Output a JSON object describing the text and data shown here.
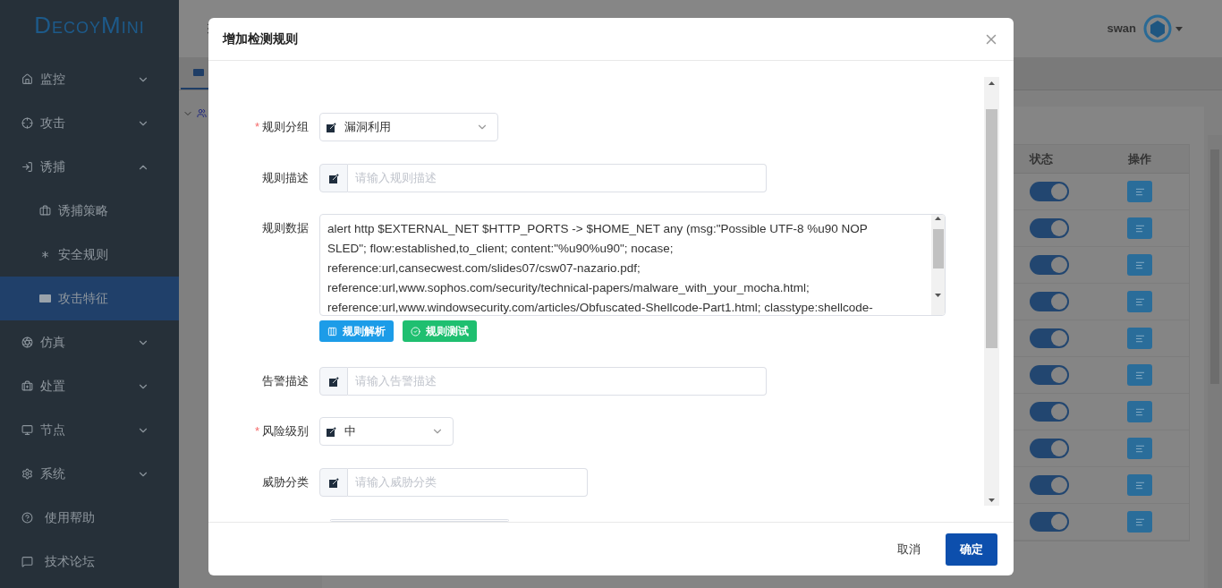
{
  "sidebar": {
    "logo": "DecoyMini",
    "items": [
      {
        "kind": "home",
        "label": "监控",
        "expanded": false
      },
      {
        "kind": "target",
        "label": "攻击",
        "expanded": false
      },
      {
        "kind": "login",
        "label": "诱捕",
        "expanded": true,
        "children": [
          {
            "kind": "bag",
            "label": "诱捕策略",
            "selected": false
          },
          {
            "kind": "asterisk",
            "label": "安全规则",
            "selected": false
          },
          {
            "kind": "md",
            "label": "攻击特征",
            "selected": true
          }
        ]
      },
      {
        "kind": "aperture",
        "label": "仿真",
        "expanded": false
      },
      {
        "kind": "kit",
        "label": "处置",
        "expanded": false
      },
      {
        "kind": "monitor",
        "label": "节点",
        "expanded": false
      },
      {
        "kind": "gear",
        "label": "系统",
        "expanded": false
      },
      {
        "kind": "help",
        "label": "使用帮助"
      },
      {
        "kind": "chat",
        "label": "技术论坛"
      }
    ]
  },
  "header": {
    "user": "swan"
  },
  "table": {
    "columns": [
      "状态",
      "操作"
    ],
    "rows": [
      {
        "on": true
      },
      {
        "on": true
      },
      {
        "on": true
      },
      {
        "on": true
      },
      {
        "on": true
      },
      {
        "on": true
      },
      {
        "on": true
      },
      {
        "on": true
      },
      {
        "on": true
      },
      {
        "on": true
      }
    ]
  },
  "dialog": {
    "title": "增加检测规则",
    "required_mark": "*",
    "fields": [
      {
        "kind": "select",
        "label": "规则分组",
        "required": true,
        "value": "漏洞利用"
      },
      {
        "kind": "input",
        "label": "规则描述",
        "required": false,
        "placeholder": "请输入规则描述"
      },
      {
        "kind": "textarea",
        "label": "规则数据",
        "required": false,
        "lines": [
          "alert http $EXTERNAL_NET $HTTP_PORTS -> $HOME_NET any (msg:\"Possible UTF-8 %u90 NOP",
          "SLED\"; flow:established,to_client; content:\"%u90%u90\"; nocase;",
          "reference:url,cansecwest.com/slides07/csw07-nazario.pdf;",
          "reference:url,www.sophos.com/security/technical-papers/malware_with_your_mocha.html;",
          "reference:url,www.windowsecurity.com/articles/Obfuscated-Shellcode-Part1.html; classtype:shellcode-"
        ],
        "buttons": [
          {
            "kind": "parse",
            "label": "规则解析"
          },
          {
            "kind": "test",
            "label": "规则测试"
          }
        ]
      },
      {
        "kind": "input",
        "label": "告警描述",
        "required": false,
        "placeholder": "请输入告警描述"
      },
      {
        "kind": "select",
        "label": "风险级别",
        "required": true,
        "value": "中"
      },
      {
        "kind": "input",
        "label": "威胁分类",
        "required": false,
        "placeholder": "请输入威胁分类"
      }
    ],
    "buttons": [
      {
        "kind": "secondary",
        "label": "取消"
      },
      {
        "kind": "primary",
        "label": "确定"
      }
    ]
  }
}
